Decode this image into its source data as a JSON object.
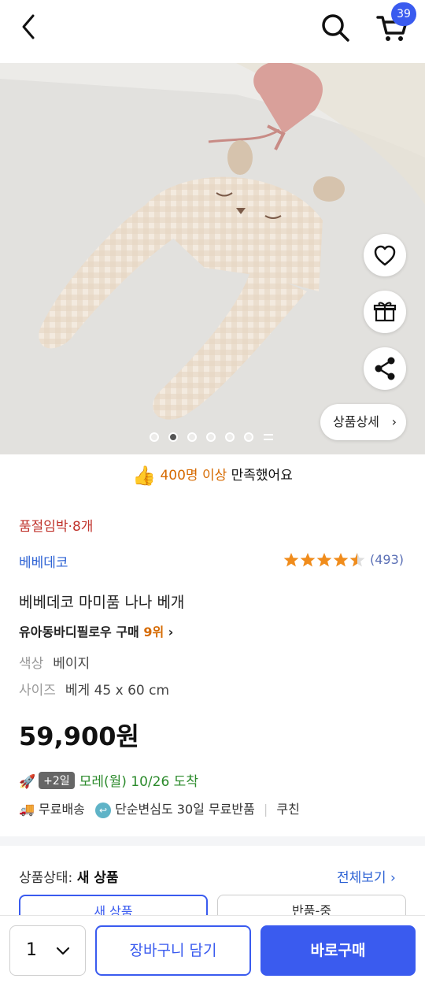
{
  "header": {
    "cart_count": "39",
    "accent": "#3a5bef"
  },
  "hero": {
    "detail_label": "상품상세",
    "page_count": 6,
    "active_page": 2
  },
  "satisfaction": {
    "highlight": "400명 이상",
    "rest": " 만족했어요"
  },
  "product": {
    "stock_text": "품절임박·8개",
    "brand": "베베데코",
    "rating": 4.5,
    "review_count": "(493)",
    "title": "베베데코 마미품 나나 베개",
    "rank_prefix": "유아동바디필로우 구매 ",
    "rank_num": "9위",
    "options": [
      {
        "label": "색상",
        "value": "베이지"
      },
      {
        "label": "사이즈",
        "value": "베게 45 x 60 cm"
      }
    ],
    "price": "59,900원"
  },
  "delivery": {
    "badge": "+2일",
    "text": "모레(월) 10/26 도착",
    "free_shipping": "무료배송",
    "free_return": "단순변심도 30일 무료반품",
    "seller": "쿠친"
  },
  "condition": {
    "label": "상품상태: ",
    "value": "새 상품",
    "view_all": "전체보기",
    "cards": [
      "새 상품",
      "반품-중"
    ]
  },
  "bottom": {
    "quantity": "1",
    "add_to_cart": "장바구니 담기",
    "buy_now": "바로구매"
  },
  "colors": {
    "brand_blue": "#3a5bef",
    "warning_red": "#c0342d",
    "highlight_orange": "#d66a00",
    "delivery_green": "#2b8a2b"
  }
}
